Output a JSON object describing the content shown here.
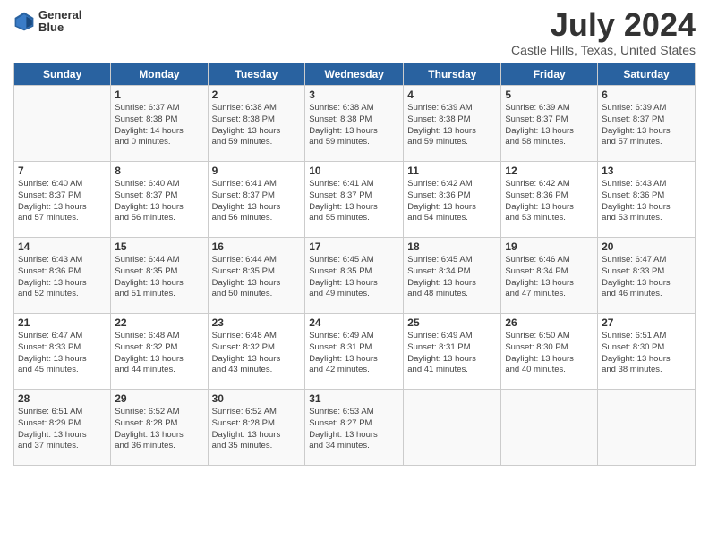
{
  "header": {
    "logo_line1": "General",
    "logo_line2": "Blue",
    "title": "July 2024",
    "subtitle": "Castle Hills, Texas, United States"
  },
  "days_of_week": [
    "Sunday",
    "Monday",
    "Tuesday",
    "Wednesday",
    "Thursday",
    "Friday",
    "Saturday"
  ],
  "weeks": [
    [
      {
        "day": "",
        "info": ""
      },
      {
        "day": "1",
        "info": "Sunrise: 6:37 AM\nSunset: 8:38 PM\nDaylight: 14 hours\nand 0 minutes."
      },
      {
        "day": "2",
        "info": "Sunrise: 6:38 AM\nSunset: 8:38 PM\nDaylight: 13 hours\nand 59 minutes."
      },
      {
        "day": "3",
        "info": "Sunrise: 6:38 AM\nSunset: 8:38 PM\nDaylight: 13 hours\nand 59 minutes."
      },
      {
        "day": "4",
        "info": "Sunrise: 6:39 AM\nSunset: 8:38 PM\nDaylight: 13 hours\nand 59 minutes."
      },
      {
        "day": "5",
        "info": "Sunrise: 6:39 AM\nSunset: 8:37 PM\nDaylight: 13 hours\nand 58 minutes."
      },
      {
        "day": "6",
        "info": "Sunrise: 6:39 AM\nSunset: 8:37 PM\nDaylight: 13 hours\nand 57 minutes."
      }
    ],
    [
      {
        "day": "7",
        "info": "Sunrise: 6:40 AM\nSunset: 8:37 PM\nDaylight: 13 hours\nand 57 minutes."
      },
      {
        "day": "8",
        "info": "Sunrise: 6:40 AM\nSunset: 8:37 PM\nDaylight: 13 hours\nand 56 minutes."
      },
      {
        "day": "9",
        "info": "Sunrise: 6:41 AM\nSunset: 8:37 PM\nDaylight: 13 hours\nand 56 minutes."
      },
      {
        "day": "10",
        "info": "Sunrise: 6:41 AM\nSunset: 8:37 PM\nDaylight: 13 hours\nand 55 minutes."
      },
      {
        "day": "11",
        "info": "Sunrise: 6:42 AM\nSunset: 8:36 PM\nDaylight: 13 hours\nand 54 minutes."
      },
      {
        "day": "12",
        "info": "Sunrise: 6:42 AM\nSunset: 8:36 PM\nDaylight: 13 hours\nand 53 minutes."
      },
      {
        "day": "13",
        "info": "Sunrise: 6:43 AM\nSunset: 8:36 PM\nDaylight: 13 hours\nand 53 minutes."
      }
    ],
    [
      {
        "day": "14",
        "info": "Sunrise: 6:43 AM\nSunset: 8:36 PM\nDaylight: 13 hours\nand 52 minutes."
      },
      {
        "day": "15",
        "info": "Sunrise: 6:44 AM\nSunset: 8:35 PM\nDaylight: 13 hours\nand 51 minutes."
      },
      {
        "day": "16",
        "info": "Sunrise: 6:44 AM\nSunset: 8:35 PM\nDaylight: 13 hours\nand 50 minutes."
      },
      {
        "day": "17",
        "info": "Sunrise: 6:45 AM\nSunset: 8:35 PM\nDaylight: 13 hours\nand 49 minutes."
      },
      {
        "day": "18",
        "info": "Sunrise: 6:45 AM\nSunset: 8:34 PM\nDaylight: 13 hours\nand 48 minutes."
      },
      {
        "day": "19",
        "info": "Sunrise: 6:46 AM\nSunset: 8:34 PM\nDaylight: 13 hours\nand 47 minutes."
      },
      {
        "day": "20",
        "info": "Sunrise: 6:47 AM\nSunset: 8:33 PM\nDaylight: 13 hours\nand 46 minutes."
      }
    ],
    [
      {
        "day": "21",
        "info": "Sunrise: 6:47 AM\nSunset: 8:33 PM\nDaylight: 13 hours\nand 45 minutes."
      },
      {
        "day": "22",
        "info": "Sunrise: 6:48 AM\nSunset: 8:32 PM\nDaylight: 13 hours\nand 44 minutes."
      },
      {
        "day": "23",
        "info": "Sunrise: 6:48 AM\nSunset: 8:32 PM\nDaylight: 13 hours\nand 43 minutes."
      },
      {
        "day": "24",
        "info": "Sunrise: 6:49 AM\nSunset: 8:31 PM\nDaylight: 13 hours\nand 42 minutes."
      },
      {
        "day": "25",
        "info": "Sunrise: 6:49 AM\nSunset: 8:31 PM\nDaylight: 13 hours\nand 41 minutes."
      },
      {
        "day": "26",
        "info": "Sunrise: 6:50 AM\nSunset: 8:30 PM\nDaylight: 13 hours\nand 40 minutes."
      },
      {
        "day": "27",
        "info": "Sunrise: 6:51 AM\nSunset: 8:30 PM\nDaylight: 13 hours\nand 38 minutes."
      }
    ],
    [
      {
        "day": "28",
        "info": "Sunrise: 6:51 AM\nSunset: 8:29 PM\nDaylight: 13 hours\nand 37 minutes."
      },
      {
        "day": "29",
        "info": "Sunrise: 6:52 AM\nSunset: 8:28 PM\nDaylight: 13 hours\nand 36 minutes."
      },
      {
        "day": "30",
        "info": "Sunrise: 6:52 AM\nSunset: 8:28 PM\nDaylight: 13 hours\nand 35 minutes."
      },
      {
        "day": "31",
        "info": "Sunrise: 6:53 AM\nSunset: 8:27 PM\nDaylight: 13 hours\nand 34 minutes."
      },
      {
        "day": "",
        "info": ""
      },
      {
        "day": "",
        "info": ""
      },
      {
        "day": "",
        "info": ""
      }
    ]
  ]
}
